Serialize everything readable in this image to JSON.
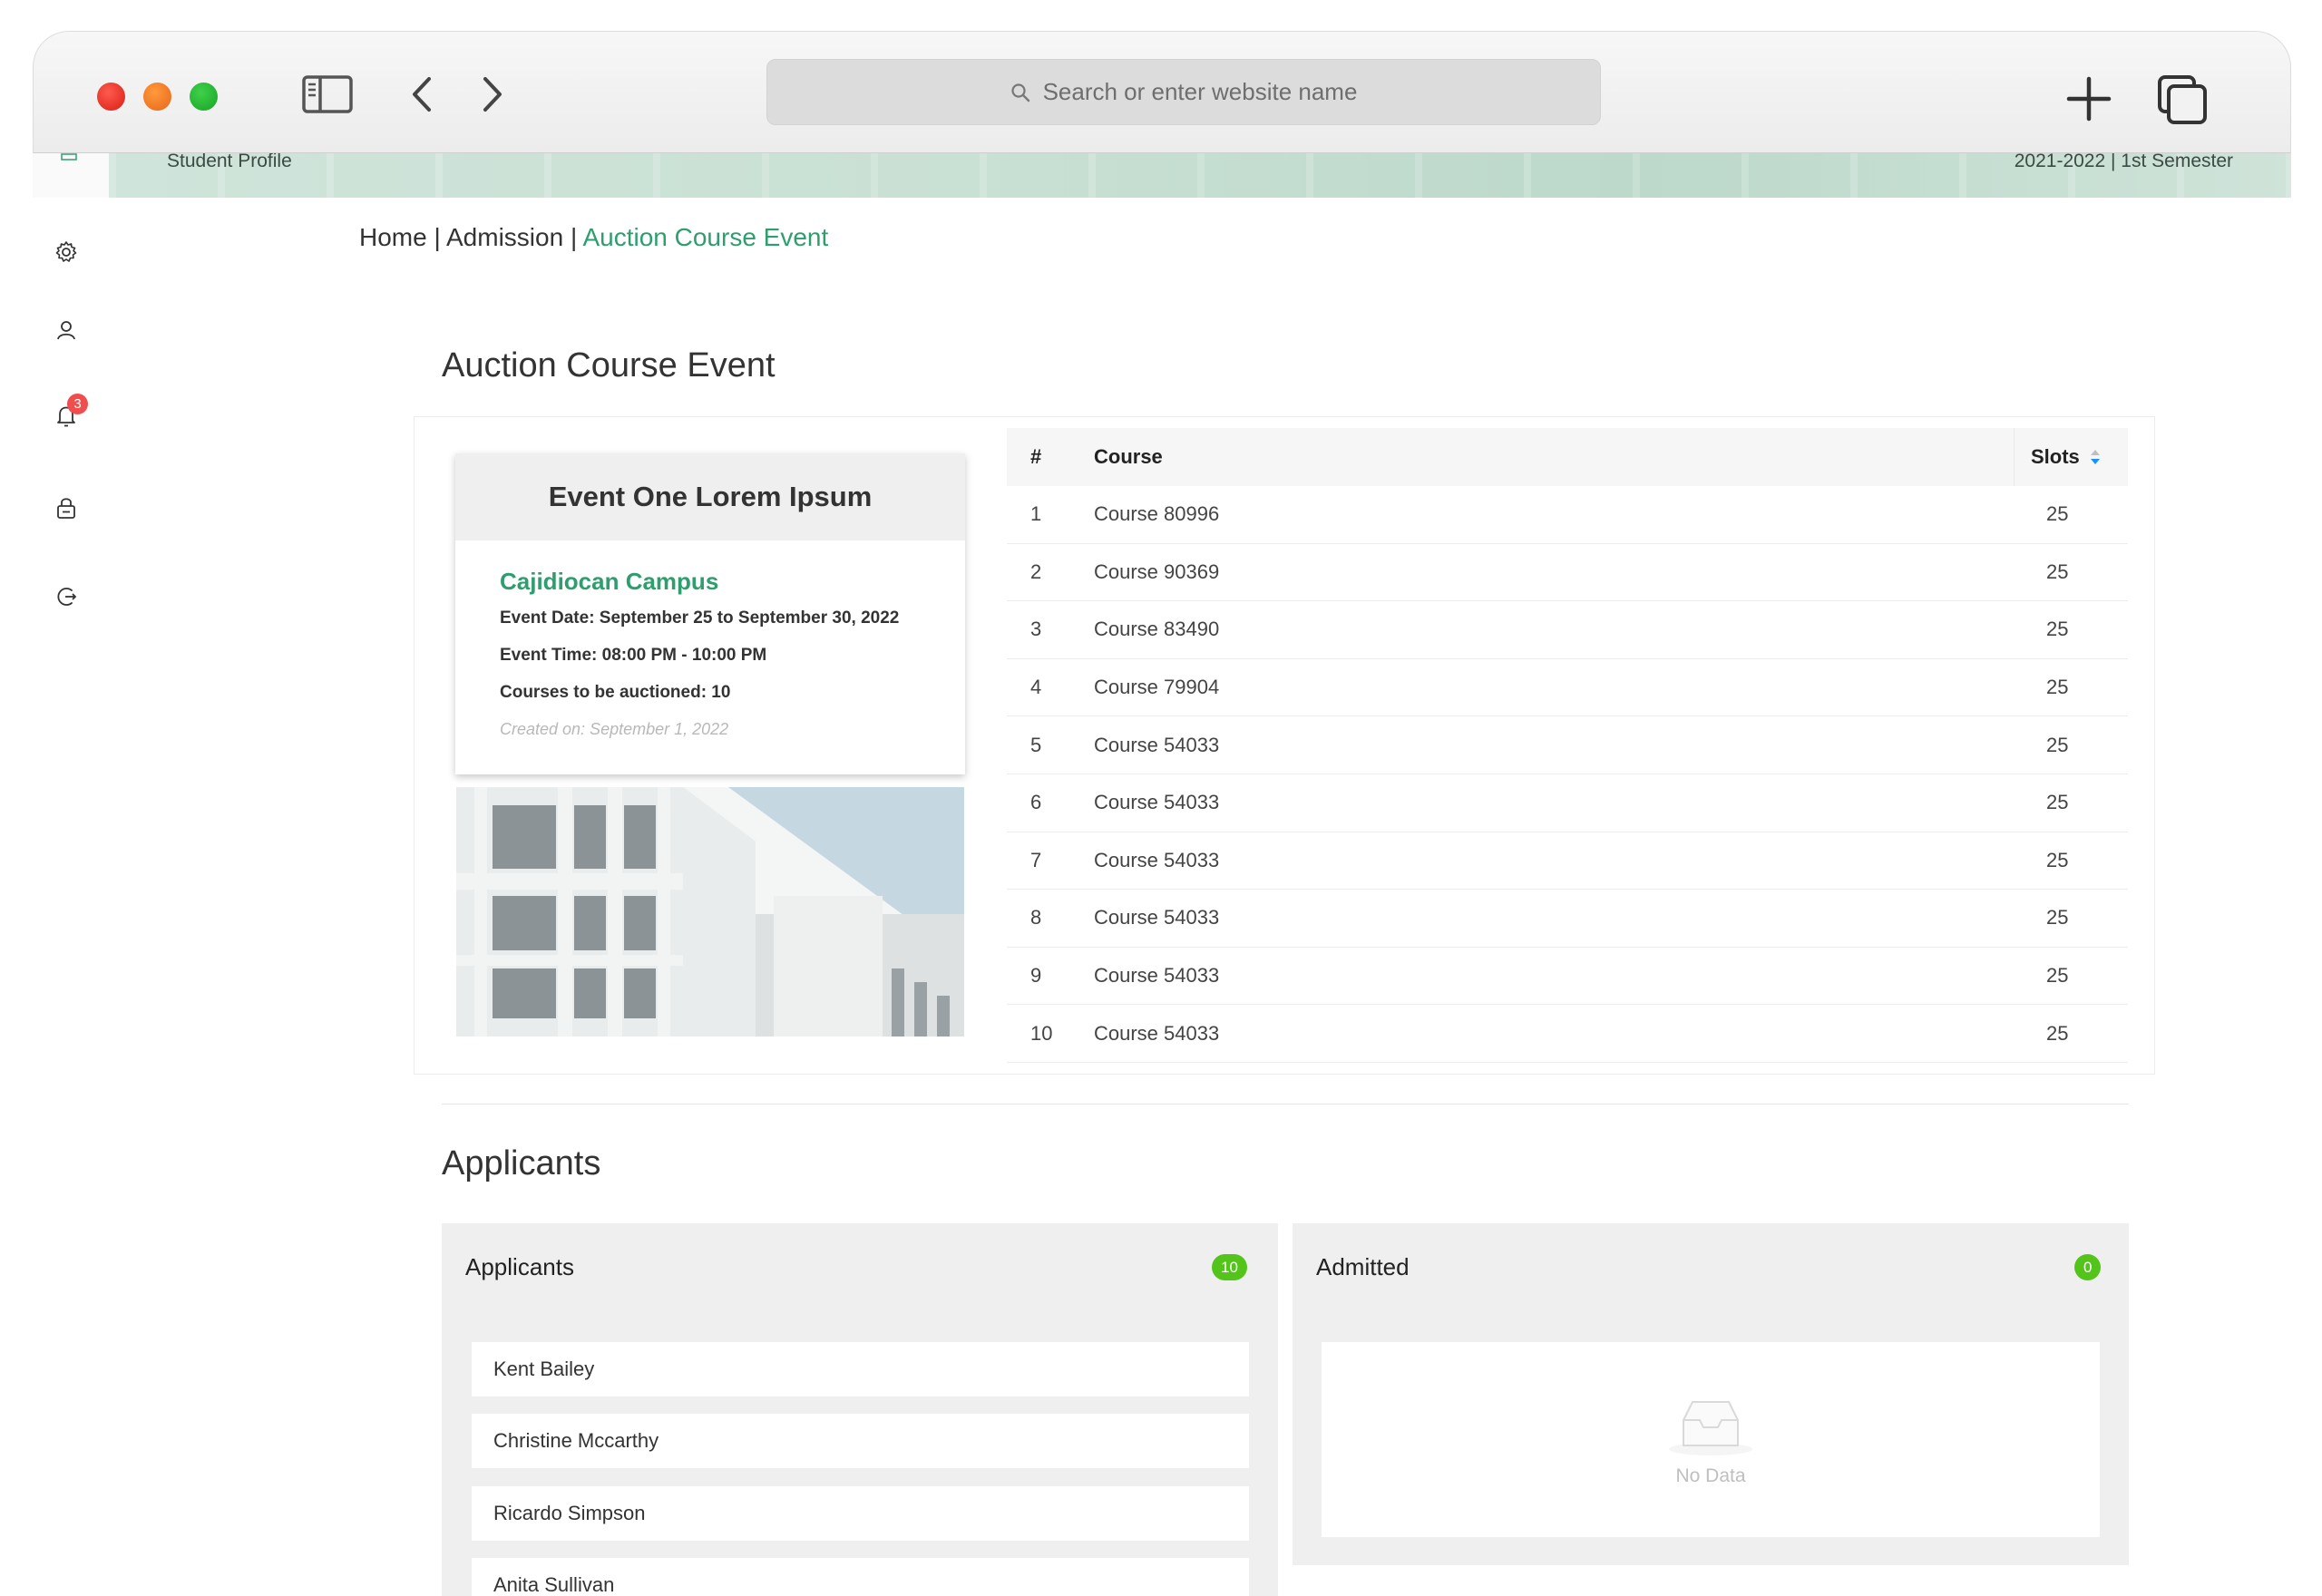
{
  "browser": {
    "address_placeholder": "Search or enter website name"
  },
  "banner": {
    "left_text": "Student Profile",
    "right_text": "2021-2022 | 1st Semester"
  },
  "sidebar": {
    "items": [
      {
        "icon": "gear-icon"
      },
      {
        "icon": "user-icon"
      },
      {
        "icon": "bell-icon",
        "badge": "3"
      },
      {
        "icon": "lock-icon"
      },
      {
        "icon": "logout-icon"
      }
    ]
  },
  "breadcrumb": {
    "home": "Home",
    "sep1": " | ",
    "admission": "Admission",
    "sep2": " | ",
    "current": "Auction Course Event"
  },
  "event_section": {
    "title": "Auction Course Event",
    "card": {
      "name": "Event One Lorem Ipsum",
      "campus": "Cajidiocan Campus",
      "date": "Event Date: September 25 to September 30, 2022",
      "time": "Event Time: 08:00 PM - 10:00 PM",
      "courses": "Courses to be auctioned: 10",
      "created": "Created on: September 1, 2022"
    },
    "table": {
      "headers": {
        "num": "#",
        "course": "Course",
        "slots": "Slots"
      },
      "rows": [
        {
          "num": "1",
          "course": "Course 80996",
          "slots": "25"
        },
        {
          "num": "2",
          "course": "Course 90369",
          "slots": "25"
        },
        {
          "num": "3",
          "course": "Course 83490",
          "slots": "25"
        },
        {
          "num": "4",
          "course": "Course 79904",
          "slots": "25"
        },
        {
          "num": "5",
          "course": "Course 54033",
          "slots": "25"
        },
        {
          "num": "6",
          "course": "Course 54033",
          "slots": "25"
        },
        {
          "num": "7",
          "course": "Course 54033",
          "slots": "25"
        },
        {
          "num": "8",
          "course": "Course 54033",
          "slots": "25"
        },
        {
          "num": "9",
          "course": "Course 54033",
          "slots": "25"
        },
        {
          "num": "10",
          "course": "Course 54033",
          "slots": "25"
        }
      ]
    }
  },
  "applicants_section": {
    "title": "Applicants",
    "applicants": {
      "label": "Applicants",
      "count": "10",
      "items": [
        "Kent Bailey",
        "Christine Mccarthy",
        "Ricardo Simpson",
        "Anita Sullivan"
      ]
    },
    "admitted": {
      "label": "Admitted",
      "count": "0",
      "empty_text": "No Data"
    }
  },
  "colors": {
    "accent_green": "#2e9e6e",
    "badge_green": "#52c41a",
    "badge_red": "#f24d4d"
  }
}
